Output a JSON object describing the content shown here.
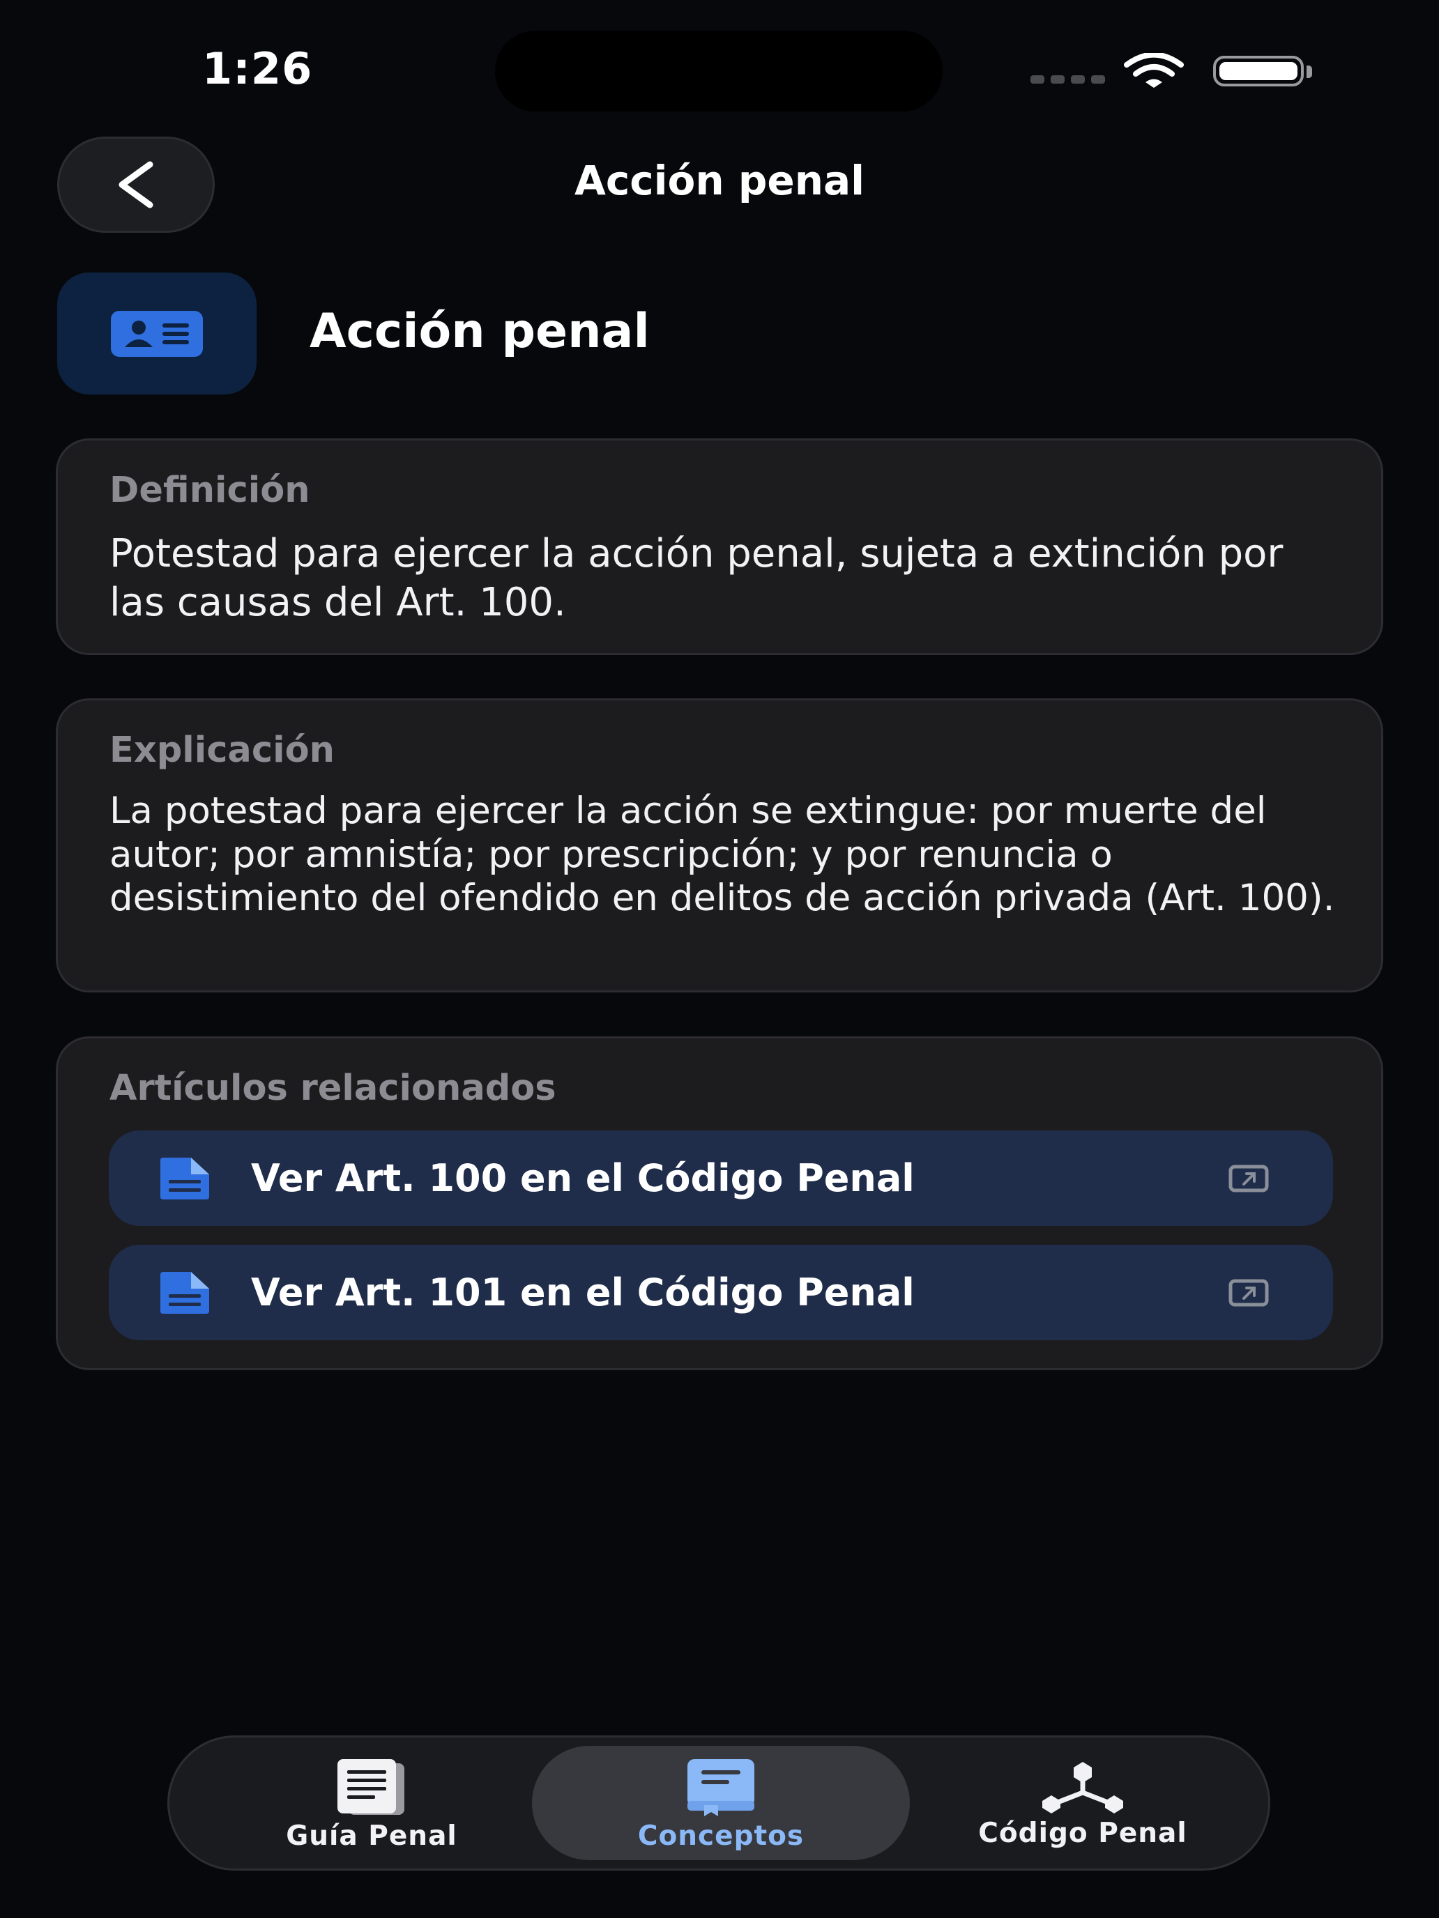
{
  "status_bar": {
    "time": "1:26"
  },
  "nav": {
    "title": "Acción penal",
    "back_icon": "chevron-left-icon"
  },
  "header": {
    "title": "Acción penal",
    "icon": "id-card-icon",
    "accent": "#2f6fe0"
  },
  "definition": {
    "label": "Definición",
    "text": "Potestad para ejercer la acción penal, sujeta a extinción por las causas del Art. 100."
  },
  "explanation": {
    "label": "Explicación",
    "text": "La potestad para ejercer la acción se extingue: por muerte del autor; por amnistía; por prescripción; y por renuncia o desistimiento del ofendido en delitos de acción privada (Art. 100)."
  },
  "related": {
    "label": "Artículos relacionados",
    "items": [
      {
        "label": "Ver Art. 100 en el Código Penal",
        "icon": "document-icon",
        "action_icon": "external-link-icon"
      },
      {
        "label": "Ver Art. 101 en el Código Penal",
        "icon": "document-icon",
        "action_icon": "external-link-icon"
      }
    ]
  },
  "tabbar": {
    "tabs": [
      {
        "label": "Guía Penal",
        "icon": "book-pages-icon",
        "active": false
      },
      {
        "label": "Conceptos",
        "icon": "book-closed-icon",
        "active": true
      },
      {
        "label": "Código Penal",
        "icon": "hierarchy-nodes-icon",
        "active": false
      }
    ],
    "active_color": "#8bb8f6"
  }
}
